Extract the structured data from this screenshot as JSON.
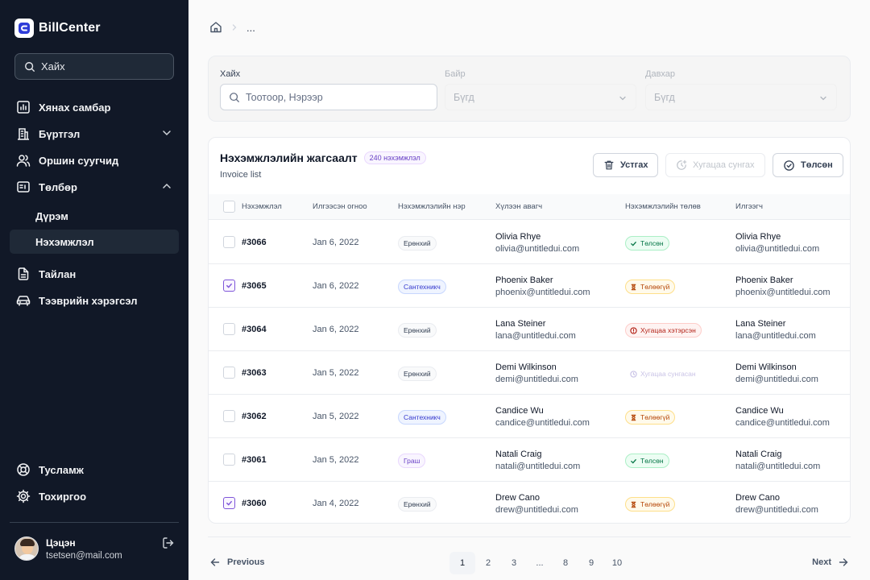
{
  "app": {
    "name": "BillCenter"
  },
  "sidebar": {
    "search_placeholder": "Хайх",
    "nav": [
      {
        "label": "Хянах самбар",
        "icon": "chart-icon"
      },
      {
        "label": "Бүртгэл",
        "icon": "building-icon"
      },
      {
        "label": "Оршин суугчид",
        "icon": "users-icon"
      },
      {
        "label": "Төлбөр",
        "icon": "receipt-icon"
      },
      {
        "label": "Тайлан",
        "icon": "file-icon"
      },
      {
        "label": "Тээврийн хэрэгсэл",
        "icon": "car-icon"
      }
    ],
    "sub": [
      {
        "label": "Дүрэм"
      },
      {
        "label": "Нэхэмжлэл"
      }
    ],
    "bottom": [
      {
        "label": "Тусламж",
        "icon": "lifebuoy-icon"
      },
      {
        "label": "Тохиргоо",
        "icon": "gear-icon"
      }
    ],
    "user": {
      "name": "Цэцэн",
      "email": "tsetsen@mail.com"
    }
  },
  "breadcrumb": {
    "current": "..."
  },
  "filters": {
    "search_label": "Хайх",
    "search_placeholder": "Тоотоор, Нэрээр",
    "building_label": "Байр",
    "building_value": "Бүгд",
    "floor_label": "Давхар",
    "floor_value": "Бүгд"
  },
  "invoices": {
    "title": "Нэхэмжлэлийн жагсаалт",
    "count_badge": "240 нэхэмжлэл",
    "subtitle": "Invoice list",
    "actions": {
      "delete": "Устгах",
      "extend": "Хугацаа сунгах",
      "paid": "Төлсөн"
    },
    "columns": [
      "Нэхэмжлэл",
      "Илгээсэн огноо",
      "Нэхэмжлэлийн нэр",
      "Хүлээн авагч",
      "Нэхэмжлэлийн төлөв",
      "Илгээгч"
    ],
    "rows": [
      {
        "checked": false,
        "id": "#3066",
        "date": "Jan 6, 2022",
        "type": "Ерөнхий",
        "type_style": "gray",
        "recipient": "Olivia Rhye",
        "recipient_email": "olivia@untitledui.com",
        "status": "Төлсөн",
        "status_kind": "paid",
        "sender": "Olivia Rhye",
        "sender_email": "olivia@untitledui.com"
      },
      {
        "checked": true,
        "id": "#3065",
        "date": "Jan 6, 2022",
        "type": "Сантехникч",
        "type_style": "blue",
        "recipient": "Phoenix Baker",
        "recipient_email": "phoenix@untitledui.com",
        "status": "Төлөөгүй",
        "status_kind": "unpaid",
        "sender": "Phoenix Baker",
        "sender_email": "phoenix@untitledui.com"
      },
      {
        "checked": false,
        "id": "#3064",
        "date": "Jan 6, 2022",
        "type": "Ерөнхий",
        "type_style": "gray",
        "recipient": "Lana Steiner",
        "recipient_email": "lana@untitledui.com",
        "status": "Хугацаа хэтэрсэн",
        "status_kind": "overdue",
        "sender": "Lana Steiner",
        "sender_email": "lana@untitledui.com"
      },
      {
        "checked": false,
        "id": "#3063",
        "date": "Jan 5, 2022",
        "type": "Ерөнхий",
        "type_style": "gray",
        "recipient": "Demi Wilkinson",
        "recipient_email": "demi@untitledui.com",
        "status": "Хугацаа сунгасан",
        "status_kind": "ext",
        "sender": "Demi Wilkinson",
        "sender_email": "demi@untitledui.com"
      },
      {
        "checked": false,
        "id": "#3062",
        "date": "Jan 5, 2022",
        "type": "Сантехникч",
        "type_style": "blue",
        "recipient": "Candice Wu",
        "recipient_email": "candice@untitledui.com",
        "status": "Төлөөгүй",
        "status_kind": "unpaid",
        "sender": "Candice Wu",
        "sender_email": "candice@untitledui.com"
      },
      {
        "checked": false,
        "id": "#3061",
        "date": "Jan 5, 2022",
        "type": "Граш",
        "type_style": "purple",
        "recipient": "Natali Craig",
        "recipient_email": "natali@untitledui.com",
        "status": "Төлсөн",
        "status_kind": "paid",
        "sender": "Natali Craig",
        "sender_email": "natali@untitledui.com"
      },
      {
        "checked": true,
        "id": "#3060",
        "date": "Jan 4, 2022",
        "type": "Ерөнхий",
        "type_style": "gray",
        "recipient": "Drew Cano",
        "recipient_email": "drew@untitledui.com",
        "status": "Төлөөгүй",
        "status_kind": "unpaid",
        "sender": "Drew Cano",
        "sender_email": "drew@untitledui.com"
      }
    ]
  },
  "pagination": {
    "prev": "Previous",
    "next": "Next",
    "pages": [
      "1",
      "2",
      "3",
      "...",
      "8",
      "9",
      "10"
    ],
    "current": "1"
  }
}
